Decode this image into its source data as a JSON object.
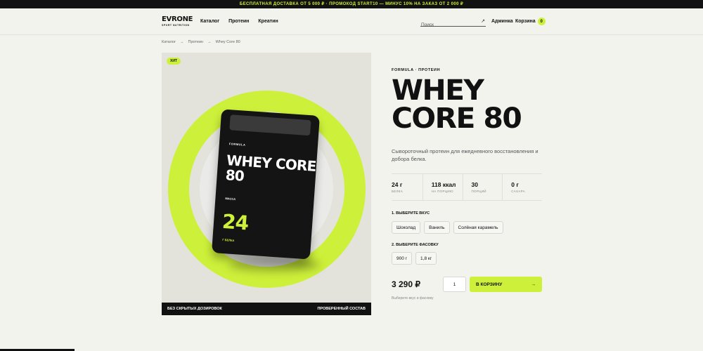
{
  "promo_bar": "БЕСПЛАТНАЯ ДОСТАВКА ОТ 5 000 ₽ · ПРОМОКОД START10 — МИНУС 10% НА ЗАКАЗ ОТ 2 000 ₽",
  "header": {
    "logo": "EVRONE",
    "logo_sub": "SPORT NUTRITION",
    "nav": [
      "Каталог",
      "Протеин",
      "Креатин"
    ],
    "search_placeholder": "Поиск",
    "admin": "Админка",
    "cart_label": "Корзина",
    "cart_count": "0"
  },
  "breadcrumb": [
    "Каталог",
    "→",
    "Протеин",
    "→",
    "Whey Core 80"
  ],
  "hero": {
    "badge": "ХИТ",
    "pack_formula": "FORMULA",
    "pack_title": "WHEY CORE 80",
    "pack_mass": "МАССА",
    "pack_number": "24",
    "pack_protein": "Г БЕЛКА",
    "footer_left": "БЕЗ СКРЫТЫХ ДОЗИРОВОК",
    "footer_right": "ПРОВЕРЕННЫЙ СОСТАВ"
  },
  "product": {
    "category": "FORMULA · ПРОТЕИН",
    "title_line1": "WHEY",
    "title_line2": "CORE 80",
    "description": "Сывороточный протеин для ежедневного восстановления и добора белка.",
    "stats": [
      {
        "value": "24 г",
        "label": "БЕЛКА"
      },
      {
        "value": "118 ккал",
        "label": "НА ПОРЦИЮ"
      },
      {
        "value": "30",
        "label": "ПОРЦИЙ"
      },
      {
        "value": "0 г",
        "label": "САХАРА"
      }
    ],
    "flavor_label": "1. ВЫБЕРИТЕ ВКУС",
    "flavors": [
      "Шоколад",
      "Ваниль",
      "Солёная карамель"
    ],
    "size_label": "2. ВЫБЕРИТЕ ФАСОВКУ",
    "sizes": [
      "900 г",
      "1,8 кг"
    ],
    "price": "3 290 ₽",
    "quantity": "1",
    "add_to_cart": "В КОРЗИНУ",
    "add_arrow": "→",
    "hint": "Выберите вкус и фасовку"
  },
  "colors": {
    "accent": "#cdf03a",
    "dark": "#121212",
    "background": "#f3f3ee"
  }
}
